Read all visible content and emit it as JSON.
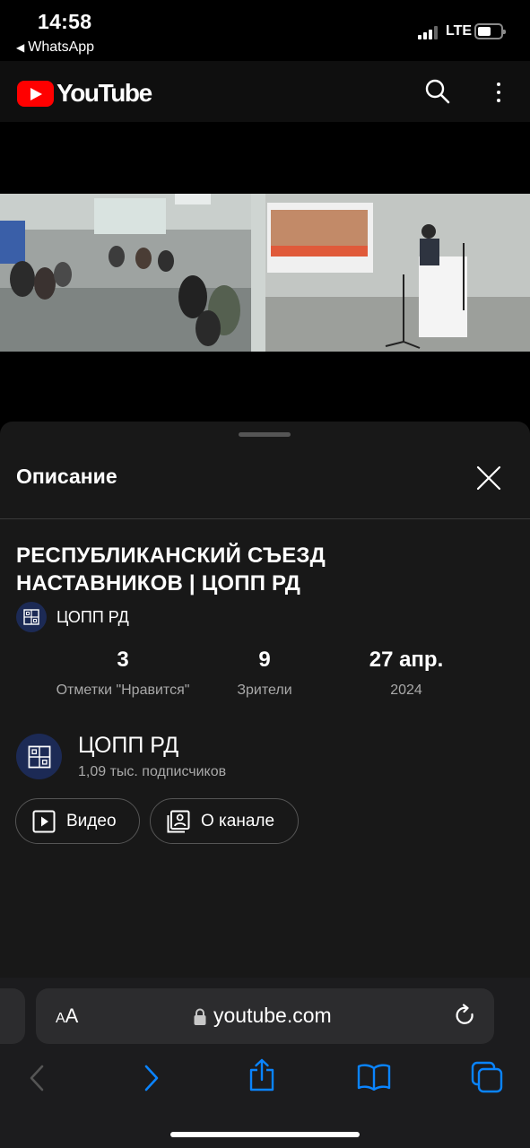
{
  "status": {
    "time": "14:58",
    "back_app": "WhatsApp",
    "network": "LTE"
  },
  "header": {
    "logo_text": "YouTube",
    "search_icon": "search-icon",
    "more_icon": "more-vertical-icon"
  },
  "description": {
    "title": "Описание",
    "video_title": "РЕСПУБЛИКАНСКИЙ СЪЕЗД НАСТАВНИКОВ | ЦОПП РД",
    "channel_small_name": "ЦОПП РД",
    "stats": [
      {
        "value": "3",
        "label": "Отметки \"Нравится\""
      },
      {
        "value": "9",
        "label": "Зрители"
      },
      {
        "value": "27 апр.",
        "label": "2024"
      }
    ],
    "channel": {
      "name": "ЦОПП РД",
      "subscribers": "1,09 тыс. подписчиков"
    },
    "buttons": {
      "videos": "Видео",
      "about": "О канале"
    }
  },
  "safari": {
    "aa_label_small": "A",
    "aa_label_large": "A",
    "url": "youtube.com"
  },
  "colors": {
    "brand_red": "#ff0000",
    "sheet_bg": "#181818",
    "accent_blue": "#0a84ff"
  }
}
